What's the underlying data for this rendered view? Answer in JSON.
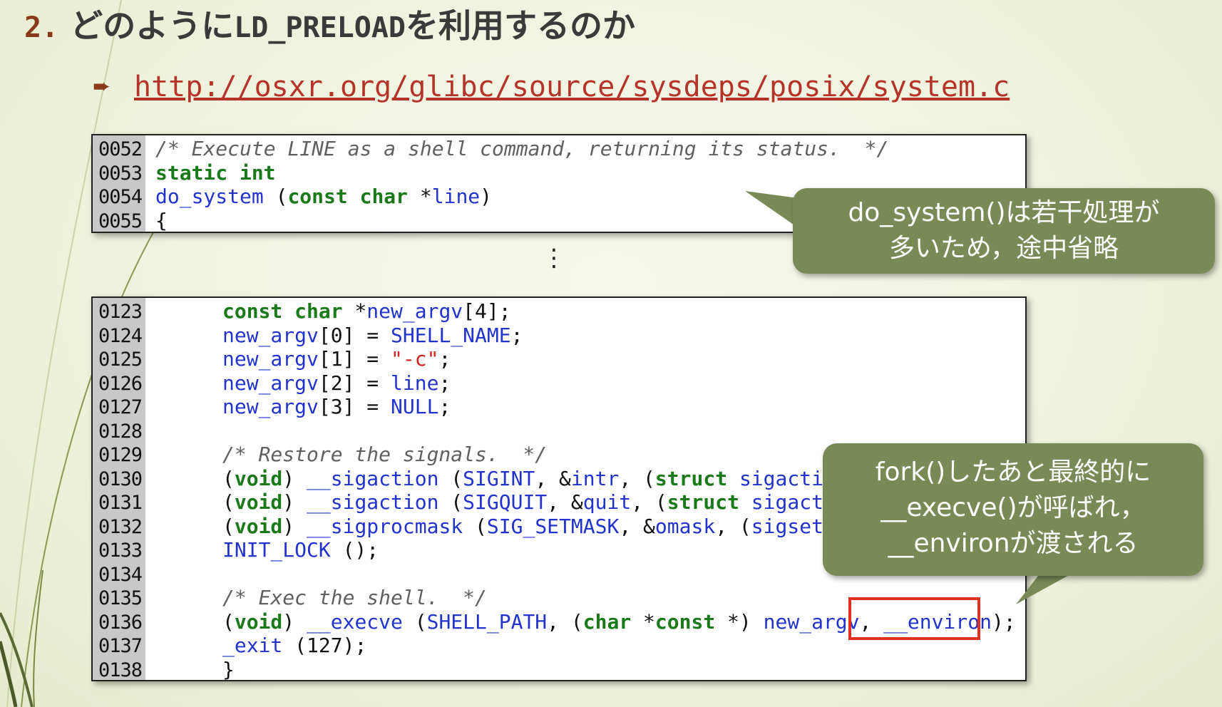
{
  "title": {
    "number": "2.",
    "text_prefix": "どのように",
    "text_mono": "LD_PRELOAD",
    "text_suffix": "を利用するのか"
  },
  "link": {
    "bullet": "➨",
    "url": "http://osxr.org/glibc/source/sysdeps/posix/system.c"
  },
  "code_top": [
    {
      "n": "0052",
      "tokens": [
        {
          "t": "cm",
          "v": "/* Execute LINE as a shell command, returning its status.  */"
        }
      ]
    },
    {
      "n": "0053",
      "tokens": [
        {
          "t": "kw",
          "v": "static int"
        }
      ]
    },
    {
      "n": "0054",
      "tokens": [
        {
          "t": "id",
          "v": "do_system"
        },
        {
          "t": "plain",
          "v": " ("
        },
        {
          "t": "kw",
          "v": "const char"
        },
        {
          "t": "plain",
          "v": " *"
        },
        {
          "t": "id",
          "v": "line"
        },
        {
          "t": "plain",
          "v": ")"
        }
      ]
    },
    {
      "n": "0055",
      "tokens": [
        {
          "t": "plain",
          "v": "{"
        }
      ]
    }
  ],
  "ellipsis": "⋮",
  "code_bottom": [
    {
      "n": "0123",
      "tokens": [
        {
          "t": "kw",
          "v": "const char"
        },
        {
          "t": "plain",
          "v": " *"
        },
        {
          "t": "id",
          "v": "new_argv"
        },
        {
          "t": "plain",
          "v": "[4];"
        }
      ]
    },
    {
      "n": "0124",
      "tokens": [
        {
          "t": "id",
          "v": "new_argv"
        },
        {
          "t": "plain",
          "v": "[0] = "
        },
        {
          "t": "id",
          "v": "SHELL_NAME"
        },
        {
          "t": "plain",
          "v": ";"
        }
      ]
    },
    {
      "n": "0125",
      "tokens": [
        {
          "t": "id",
          "v": "new_argv"
        },
        {
          "t": "plain",
          "v": "[1] = "
        },
        {
          "t": "str",
          "v": "\"-c\""
        },
        {
          "t": "plain",
          "v": ";"
        }
      ]
    },
    {
      "n": "0126",
      "tokens": [
        {
          "t": "id",
          "v": "new_argv"
        },
        {
          "t": "plain",
          "v": "[2] = "
        },
        {
          "t": "id",
          "v": "line"
        },
        {
          "t": "plain",
          "v": ";"
        }
      ]
    },
    {
      "n": "0127",
      "tokens": [
        {
          "t": "id",
          "v": "new_argv"
        },
        {
          "t": "plain",
          "v": "[3] = "
        },
        {
          "t": "id",
          "v": "NULL"
        },
        {
          "t": "plain",
          "v": ";"
        }
      ]
    },
    {
      "n": "0128",
      "tokens": []
    },
    {
      "n": "0129",
      "tokens": [
        {
          "t": "cm",
          "v": "/* Restore the signals.  */"
        }
      ]
    },
    {
      "n": "0130",
      "tokens": [
        {
          "t": "plain",
          "v": "("
        },
        {
          "t": "kw",
          "v": "void"
        },
        {
          "t": "plain",
          "v": ") "
        },
        {
          "t": "id",
          "v": "__sigaction"
        },
        {
          "t": "plain",
          "v": " ("
        },
        {
          "t": "id",
          "v": "SIGINT"
        },
        {
          "t": "plain",
          "v": ", &"
        },
        {
          "t": "id",
          "v": "intr"
        },
        {
          "t": "plain",
          "v": ", ("
        },
        {
          "t": "kw",
          "v": "struct"
        },
        {
          "t": "plain",
          "v": " "
        },
        {
          "t": "id",
          "v": "sigaction"
        }
      ]
    },
    {
      "n": "0131",
      "tokens": [
        {
          "t": "plain",
          "v": "("
        },
        {
          "t": "kw",
          "v": "void"
        },
        {
          "t": "plain",
          "v": ") "
        },
        {
          "t": "id",
          "v": "__sigaction"
        },
        {
          "t": "plain",
          "v": " ("
        },
        {
          "t": "id",
          "v": "SIGQUIT"
        },
        {
          "t": "plain",
          "v": ", &"
        },
        {
          "t": "id",
          "v": "quit"
        },
        {
          "t": "plain",
          "v": ", ("
        },
        {
          "t": "kw",
          "v": "struct"
        },
        {
          "t": "plain",
          "v": " "
        },
        {
          "t": "id",
          "v": "sigaction"
        }
      ]
    },
    {
      "n": "0132",
      "tokens": [
        {
          "t": "plain",
          "v": "("
        },
        {
          "t": "kw",
          "v": "void"
        },
        {
          "t": "plain",
          "v": ") "
        },
        {
          "t": "id",
          "v": "__sigprocmask"
        },
        {
          "t": "plain",
          "v": " ("
        },
        {
          "t": "id",
          "v": "SIG_SETMASK"
        },
        {
          "t": "plain",
          "v": ", &"
        },
        {
          "t": "id",
          "v": "omask"
        },
        {
          "t": "plain",
          "v": ", ("
        },
        {
          "t": "id",
          "v": "sigset_t"
        }
      ]
    },
    {
      "n": "0133",
      "tokens": [
        {
          "t": "id",
          "v": "INIT_LOCK"
        },
        {
          "t": "plain",
          "v": " ();"
        }
      ]
    },
    {
      "n": "0134",
      "tokens": []
    },
    {
      "n": "0135",
      "tokens": [
        {
          "t": "cm",
          "v": "/* Exec the shell.  */"
        }
      ]
    },
    {
      "n": "0136",
      "tokens": [
        {
          "t": "plain",
          "v": "("
        },
        {
          "t": "kw",
          "v": "void"
        },
        {
          "t": "plain",
          "v": ") "
        },
        {
          "t": "id",
          "v": "__execve"
        },
        {
          "t": "plain",
          "v": " ("
        },
        {
          "t": "id",
          "v": "SHELL_PATH"
        },
        {
          "t": "plain",
          "v": ", ("
        },
        {
          "t": "kw",
          "v": "char"
        },
        {
          "t": "plain",
          "v": " *"
        },
        {
          "t": "kw",
          "v": "const"
        },
        {
          "t": "plain",
          "v": " *) "
        },
        {
          "t": "id",
          "v": "new_argv"
        },
        {
          "t": "plain",
          "v": ", "
        },
        {
          "t": "id",
          "v": "__environ"
        },
        {
          "t": "plain",
          "v": ");"
        }
      ]
    },
    {
      "n": "0137",
      "tokens": [
        {
          "t": "id",
          "v": "_exit"
        },
        {
          "t": "plain",
          "v": " (127);"
        }
      ]
    },
    {
      "n": "0138",
      "tokens": [
        {
          "t": "plain",
          "v": "}"
        }
      ]
    }
  ],
  "callout1": {
    "line1": "do_system()は若干処理が",
    "line2": "多いため，途中省略"
  },
  "callout2": {
    "line1": "fork()したあと最終的に",
    "line2": "__execve()が呼ばれ，",
    "line3": "__environが渡される"
  },
  "colors": {
    "keyword": "#1a7a1a",
    "identifier": "#2233cc",
    "comment": "#606060",
    "string": "#d42020",
    "callout": "#7a8a57",
    "highlight": "#e0301e",
    "title_number": "#8a3a1a"
  }
}
